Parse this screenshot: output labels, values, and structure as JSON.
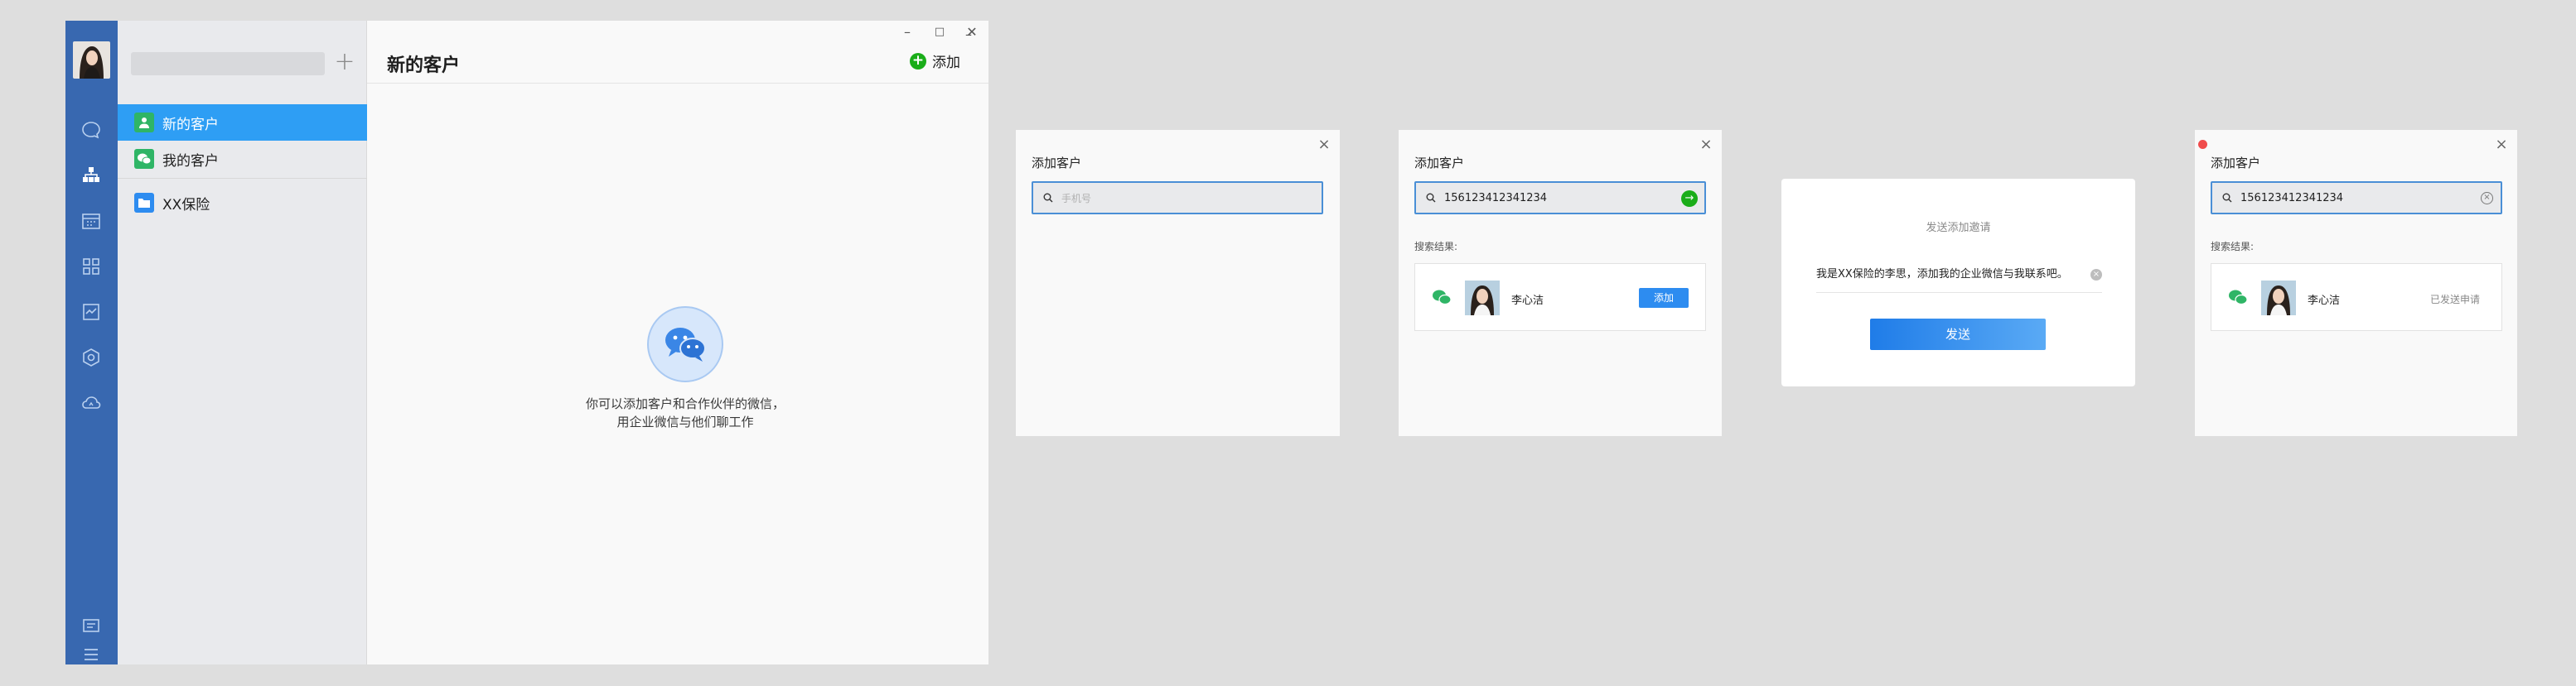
{
  "window": {
    "controls": {
      "minimize": "–",
      "maximize": "□",
      "close": "✕"
    }
  },
  "rail": {
    "icons": [
      "chat-icon",
      "contacts-icon",
      "calendar-icon",
      "apps-icon",
      "workspace-icon",
      "cube-icon",
      "cloud-icon",
      "note-icon",
      "menu-icon"
    ],
    "active_color": "#3868b0"
  },
  "sidebar": {
    "items": [
      {
        "label": "新的客户",
        "active": true
      },
      {
        "label": "我的客户",
        "active": false
      },
      {
        "label": "XX保险",
        "active": false
      }
    ]
  },
  "main": {
    "title": "新的客户",
    "add_label": "添加",
    "empty_line1": "你可以添加客户和合作伙伴的微信，",
    "empty_line2": "用企业微信与他们聊工作"
  },
  "panel1": {
    "title": "添加客户",
    "search_placeholder": "手机号"
  },
  "panel2": {
    "title": "添加客户",
    "search_value": "156123412341234",
    "result_label": "搜索结果:",
    "name": "李心洁",
    "add_label": "添加"
  },
  "dialog": {
    "title": "发送添加邀请",
    "message": "我是XX保险的李思，添加我的企业微信与我联系吧。",
    "send_label": "发送"
  },
  "panel4": {
    "title": "添加客户",
    "search_value": "156123412341234",
    "result_label": "搜索结果:",
    "name": "李心洁",
    "status": "已发送申请"
  },
  "colors": {
    "accent": "#2e9ef4",
    "rail": "#3868b0",
    "green": "#1aad19"
  }
}
